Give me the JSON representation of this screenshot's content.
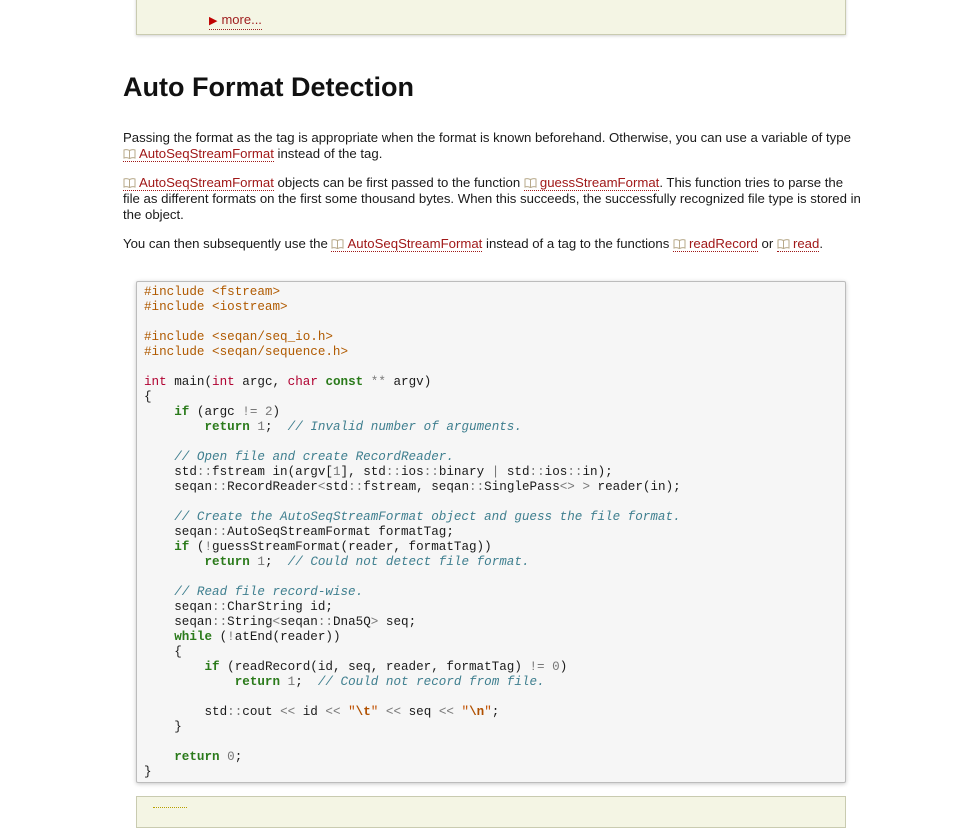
{
  "top_box": {
    "more_label": "more..."
  },
  "heading": "Auto Format Detection",
  "p1": {
    "t1": "Passing the format as the tag is appropriate when the format is known beforehand. Otherwise, you can use a variable of type ",
    "r1": "AutoSeqStreamFormat",
    "t2": " instead of the tag."
  },
  "p2": {
    "r1": "AutoSeqStreamFormat",
    "t1": " objects can be first passed to the function ",
    "r2": "guessStreamFormat",
    "t2": ". This function tries to parse the file as different formats on the first some thousand bytes. When this succeeds, the successfully recognized file type is stored in the object."
  },
  "p3": {
    "t1": "You can then subsequently use the ",
    "r1": "AutoSeqStreamFormat",
    "t2": " instead of a tag to the functions ",
    "r2": "readRecord",
    "t3": " or ",
    "r3": "read",
    "t4": "."
  },
  "code": {
    "inc1": "#include <fstream>",
    "inc2": "#include <iostream>",
    "inc3": "#include <seqan/seq_io.h>",
    "inc4": "#include <seqan/sequence.h>",
    "c1": "// Invalid number of arguments.",
    "c2": "// Open file and create RecordReader.",
    "c3": "// Create the AutoSeqStreamFormat object and guess the file format.",
    "c4": "// Could not detect file format.",
    "c5": "// Read file record-wise.",
    "c6": "// Could not record from file."
  },
  "colors": {
    "link": "#a01818",
    "box_bg": "#f4f5e4",
    "code_bg": "#f6f6f6"
  },
  "icons": {
    "doc_ref": "book-icon",
    "expand": "triangle-right-icon"
  }
}
